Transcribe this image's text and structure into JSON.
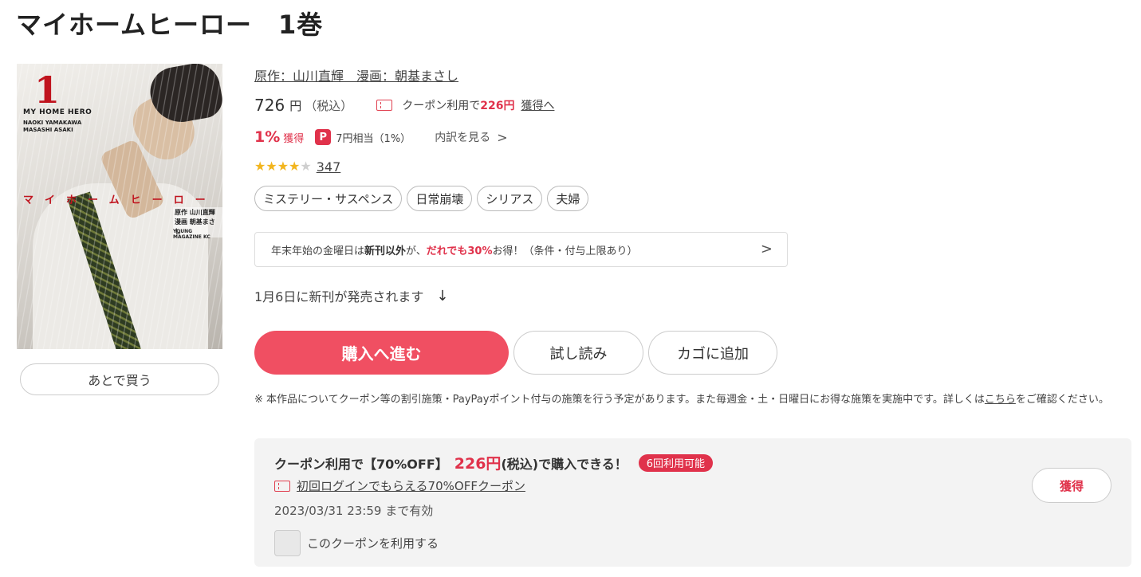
{
  "title": "マイホームヒーロー　1巻",
  "cover": {
    "volume": "1",
    "title_en": "MY HOME HERO",
    "authors_en": [
      "NAOKI YAMAKAWA",
      "MASASHI ASAKI"
    ],
    "title_jp": "マイホームヒーロー",
    "credit_lines": [
      "原作 山川直輝",
      "漫画 朝基まさし"
    ],
    "publisher": "YOUNG MAGAZINE KC"
  },
  "later_button": "あとで買う",
  "author_line": "原作：山川直輝　漫画：朝基まさし",
  "price": {
    "amount": "726",
    "unit": "円",
    "tax": "（税込）",
    "coupon_prefix": "クーポン利用で",
    "coupon_amount": "226円",
    "coupon_link": "獲得へ"
  },
  "points": {
    "percent": "1%",
    "label": "獲得",
    "paypay_icon": "P",
    "paypay_text": "7円相当（1%）",
    "detail_link": "内訳を見る",
    "detail_chevron": ">"
  },
  "rating": {
    "stars": 4,
    "max": 5,
    "count": "347"
  },
  "tags": [
    "ミステリー・サスペンス",
    "日常崩壊",
    "シリアス",
    "夫婦"
  ],
  "promo": {
    "part1": "年末年始の金曜日は",
    "bold": "新刊以外",
    "part2": "が、",
    "red": "だれでも30%",
    "part3": "お得！（条件・付与上限あり）",
    "chevron": ">"
  },
  "release": {
    "text": "1月6日に新刊が発売されます",
    "icon": "↓"
  },
  "buttons": {
    "buy": "購入へ進む",
    "trial": "試し読み",
    "cart": "カゴに追加"
  },
  "note": {
    "text": "※ 本作品についてクーポン等の割引施策・PayPayポイント付与の施策を行う予定があります。また毎週金・土・日曜日にお得な施策を実施中です。詳しくは",
    "link": "こちら",
    "tail": "をご確認ください。"
  },
  "coupon": {
    "head1": "クーポン利用で【70%OFF】",
    "amount": "226円",
    "head2": "(税込)で購入できる！",
    "badge": "6回利用可能",
    "name": "初回ログインでもらえる70%OFFクーポン",
    "expiry": "2023/03/31 23:59 まで有効",
    "checkbox_label": "このクーポンを利用する",
    "get_button": "獲得"
  },
  "colors": {
    "accent": "#f04f62",
    "red_text": "#e0324b",
    "star": "#f2b51e"
  }
}
